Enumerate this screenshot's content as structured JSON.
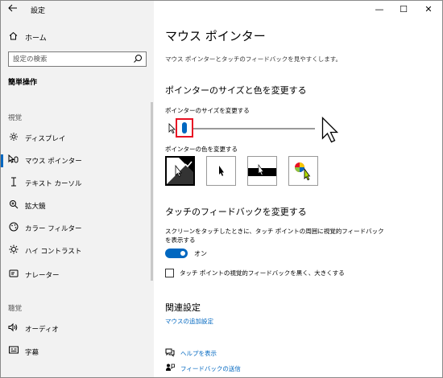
{
  "window": {
    "title": "設定",
    "back_icon": "arrow-left-icon",
    "controls": {
      "minimize": "—",
      "maximize": "☐",
      "close": "✕"
    }
  },
  "sidebar": {
    "home_label": "ホーム",
    "search_placeholder": "設定の検索",
    "section_title": "簡単操作",
    "groups": [
      {
        "title": "視覚",
        "items": [
          {
            "label": "ディスプレイ",
            "icon": "display-icon"
          },
          {
            "label": "マウス ポインター",
            "icon": "mouse-pointer-icon",
            "selected": true
          },
          {
            "label": "テキスト カーソル",
            "icon": "text-cursor-icon"
          },
          {
            "label": "拡大鏡",
            "icon": "magnifier-icon"
          },
          {
            "label": "カラー フィルター",
            "icon": "color-filter-icon"
          },
          {
            "label": "ハイ コントラスト",
            "icon": "high-contrast-icon"
          },
          {
            "label": "ナレーター",
            "icon": "narrator-icon"
          }
        ]
      },
      {
        "title": "聴覚",
        "items": [
          {
            "label": "オーディオ",
            "icon": "audio-icon"
          },
          {
            "label": "字幕",
            "icon": "captions-icon"
          }
        ]
      }
    ]
  },
  "main": {
    "title": "マウス ポインター",
    "description": "マウス ポインターとタッチのフィードバックを見やすくします。",
    "size_color_section": {
      "heading": "ポインターのサイズと色を変更する",
      "size_label": "ポインターのサイズを変更する",
      "size_value": 1,
      "size_max": 15,
      "color_label": "ポインターの色を変更する",
      "color_options": [
        "white",
        "black",
        "inverted",
        "custom"
      ],
      "selected_color": "white"
    },
    "touch_section": {
      "heading": "タッチのフィードバックを変更する",
      "description": "スクリーンをタッチしたときに、タッチ ポイントの周囲に視覚的フィードバックを表示する",
      "toggle_state": "オン",
      "checkbox_label": "タッチ ポイントの視覚的フィードバックを黒く、大きくする"
    },
    "related": {
      "heading": "関連設定",
      "link": "マウスの追加設定"
    },
    "help_links": [
      {
        "label": "ヘルプを表示",
        "icon": "help-chat-icon"
      },
      {
        "label": "フィードバックの送信",
        "icon": "feedback-icon"
      }
    ]
  },
  "colors": {
    "accent": "#0067c0",
    "highlight": "#e81123",
    "sidebar_bg": "#f2f2f2"
  }
}
